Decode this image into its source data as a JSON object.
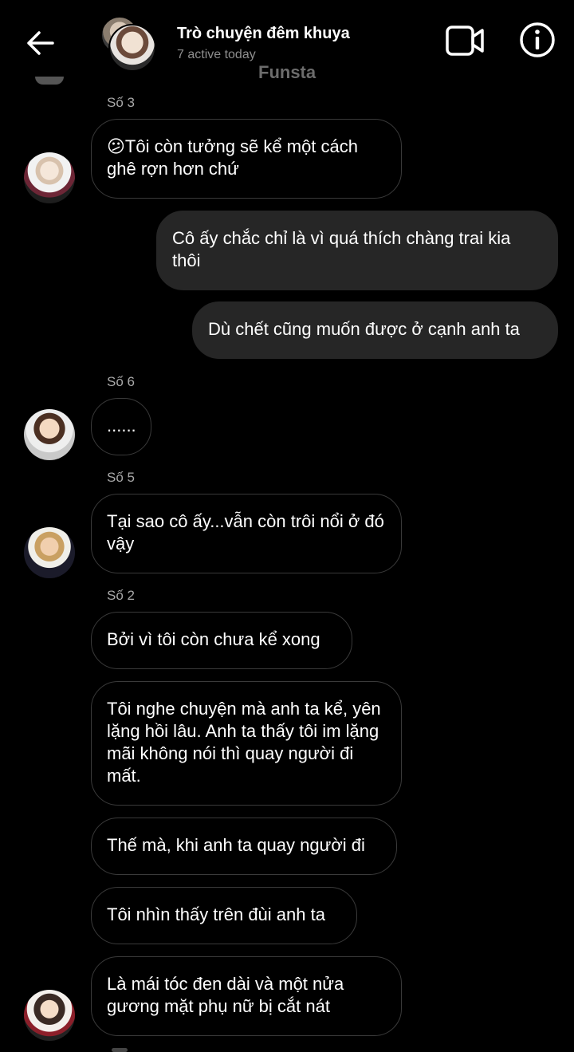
{
  "header": {
    "title": "Trò chuyện đêm khuya",
    "subtitle": "7 active today",
    "watermark": "Funsta"
  },
  "messages": [
    {
      "sender": "Số 3",
      "text": "😕Tôi còn tưởng sẽ kể một cách ghê rợn hơn chứ"
    },
    {
      "text": "Cô ấy chắc chỉ là vì quá thích chàng trai kia thôi"
    },
    {
      "text": "Dù chết cũng muốn được ở cạnh anh ta"
    },
    {
      "sender": "Số 6",
      "text": "......"
    },
    {
      "sender": "Số 5",
      "text": "Tại sao cô ấy...vẫn còn trôi nổi ở đó vậy"
    },
    {
      "sender": "Số 2",
      "text": "Bởi vì tôi còn chưa kể xong"
    },
    {
      "text": "Tôi nghe chuyện mà anh ta kể, yên lặng hồi lâu. Anh ta thấy tôi im lặng mãi không nói thì quay người đi mất."
    },
    {
      "text": "Thế mà, khi anh ta quay người đi"
    },
    {
      "text": "Tôi nhìn thấy trên đùi anh ta"
    },
    {
      "text": "Là mái tóc đen dài và một nửa gương mặt phụ nữ bị cắt nát"
    }
  ],
  "icons": {
    "back": "arrow-left-icon",
    "video": "video-camera-icon",
    "info": "info-icon"
  },
  "colors": {
    "background": "#000000",
    "outgoing_bubble": "#262626",
    "incoming_border": "#3a3a3a",
    "secondary_text": "#8e8e8e"
  }
}
